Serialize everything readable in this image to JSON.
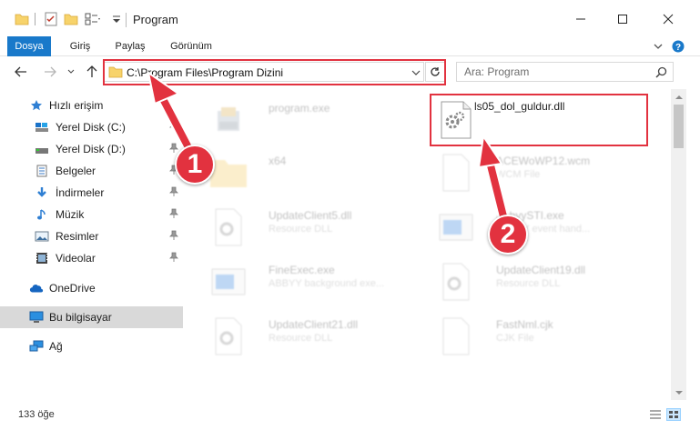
{
  "window": {
    "title": "Program",
    "minimize": "—",
    "maximize": "☐",
    "close": "✕"
  },
  "ribbon": {
    "tabs": [
      {
        "label": "Dosya",
        "active": true
      },
      {
        "label": "Giriş"
      },
      {
        "label": "Paylaş"
      },
      {
        "label": "Görünüm"
      }
    ]
  },
  "nav": {
    "address": "C:\\Program Files\\Program Dizini",
    "search_placeholder": "Ara: Program"
  },
  "sidebar": {
    "items": [
      {
        "label": "Hızlı erişim",
        "icon": "star-icon",
        "pinned": false
      },
      {
        "label": "Yerel Disk (C:)",
        "icon": "drive-icon",
        "pinned": true
      },
      {
        "label": "Yerel Disk (D:)",
        "icon": "drive-icon",
        "pinned": true
      },
      {
        "label": "Belgeler",
        "icon": "documents-icon",
        "pinned": true
      },
      {
        "label": "İndirmeler",
        "icon": "download-icon",
        "pinned": true
      },
      {
        "label": "Müzik",
        "icon": "music-icon",
        "pinned": true
      },
      {
        "label": "Resimler",
        "icon": "pictures-icon",
        "pinned": true
      },
      {
        "label": "Videolar",
        "icon": "video-icon",
        "pinned": true
      },
      {
        "label": "OneDrive",
        "icon": "cloud-icon",
        "pinned": false
      },
      {
        "label": "Bu bilgisayar",
        "icon": "computer-icon",
        "pinned": false,
        "selected": true
      },
      {
        "label": "Ağ",
        "icon": "network-icon",
        "pinned": false
      }
    ]
  },
  "files": [
    {
      "name": "program.exe",
      "sub": "",
      "icon": "exe-icon"
    },
    {
      "name": "ls05_dol_guldur.dll",
      "sub": "",
      "icon": "dll-icon",
      "highlighted": true
    },
    {
      "name": "x64",
      "sub": "",
      "icon": "folder-icon"
    },
    {
      "name": "ACEWoWP12.wcm",
      "sub": "WCM File",
      "icon": "file-icon"
    },
    {
      "name": "UpdateClient5.dll",
      "sub": "Resource DLL",
      "icon": "dll-icon"
    },
    {
      "name": "AbbyySTI.exe",
      "sub": "ABBYY event hand...",
      "icon": "exe-icon"
    },
    {
      "name": "FineExec.exe",
      "sub": "ABBYY background exe...",
      "icon": "exe-icon"
    },
    {
      "name": "UpdateClient19.dll",
      "sub": "Resource DLL",
      "icon": "dll-icon"
    },
    {
      "name": "UpdateClient21.dll",
      "sub": "Resource DLL",
      "icon": "dll-icon"
    },
    {
      "name": "FastNml.cjk",
      "sub": "CJK File",
      "icon": "file-icon"
    }
  ],
  "status": {
    "count_text": "133 öğe"
  },
  "annotations": {
    "badge_1": "1",
    "badge_2": "2",
    "color": "#e2323f"
  },
  "colors": {
    "accent": "#1979ca",
    "selection": "#cce8ff",
    "annotation": "#e2323f"
  }
}
